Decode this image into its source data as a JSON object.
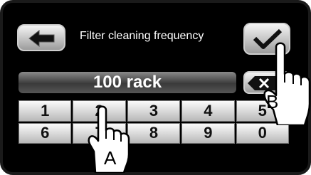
{
  "header": {
    "back_icon": "arrow-left-icon",
    "title": "Filter cleaning frequency",
    "confirm_icon": "checkmark-icon"
  },
  "display": {
    "value": "100 rack",
    "delete_icon": "backspace-x-icon"
  },
  "keypad": {
    "keys": [
      "1",
      "2",
      "3",
      "4",
      "5",
      "6",
      "7",
      "8",
      "9",
      "0"
    ]
  },
  "callouts": {
    "a_label": "A",
    "b_label": "B",
    "hand_icon": "pointing-hand-icon"
  },
  "colors": {
    "screen_background": "#000000",
    "text_light": "#ffffff",
    "button_top": "#f4f4f4",
    "button_bottom": "#9c9c9c"
  }
}
